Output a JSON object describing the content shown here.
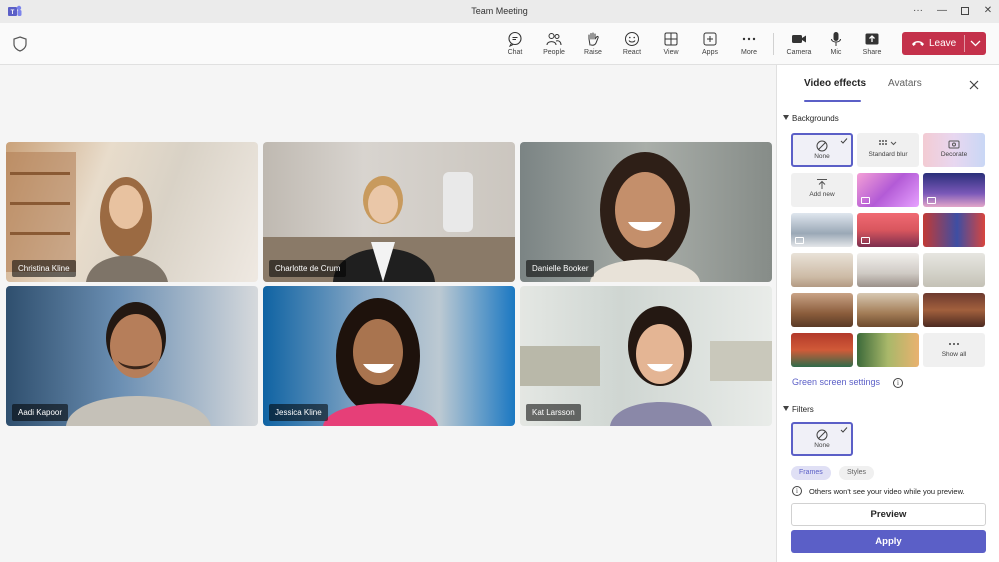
{
  "window": {
    "title": "Team Meeting",
    "controls": [
      "more",
      "minimize",
      "maximize",
      "close"
    ]
  },
  "toolbar": {
    "buttons": [
      {
        "label": "Chat",
        "icon": "chat-icon"
      },
      {
        "label": "People",
        "icon": "people-icon"
      },
      {
        "label": "Raise",
        "icon": "raise-hand-icon"
      },
      {
        "label": "React",
        "icon": "smiley-icon"
      },
      {
        "label": "View",
        "icon": "grid-icon"
      },
      {
        "label": "Apps",
        "icon": "add-apps-icon"
      },
      {
        "label": "More",
        "icon": "more-icon"
      },
      {
        "label": "Camera",
        "icon": "camera-icon"
      },
      {
        "label": "Mic",
        "icon": "mic-icon"
      },
      {
        "label": "Share",
        "icon": "share-icon"
      }
    ],
    "leave_label": "Leave",
    "leave_color": "#c4314b"
  },
  "participants": [
    {
      "name": "Christina Kline"
    },
    {
      "name": "Charlotte de Crum"
    },
    {
      "name": "Danielle Booker"
    },
    {
      "name": "Aadi Kapoor"
    },
    {
      "name": "Jessica Kline"
    },
    {
      "name": "Kat Larsson"
    }
  ],
  "panel": {
    "tabs": [
      {
        "label": "Video effects",
        "active": true
      },
      {
        "label": "Avatars",
        "active": false
      }
    ],
    "backgrounds_title": "Backgrounds",
    "options": {
      "none": "None",
      "blur": "Standard blur",
      "decorate": "Decorate",
      "add_new": "Add new",
      "show_all": "Show all"
    },
    "green_screen_link": "Green screen settings",
    "filters_title": "Filters",
    "filter_none": "None",
    "filter_tabs": [
      {
        "label": "Frames",
        "active": true
      },
      {
        "label": "Styles",
        "active": false
      }
    ],
    "notice": "Others won't see your video while you preview.",
    "preview_label": "Preview",
    "apply_label": "Apply",
    "accent": "#5b5fc7"
  }
}
